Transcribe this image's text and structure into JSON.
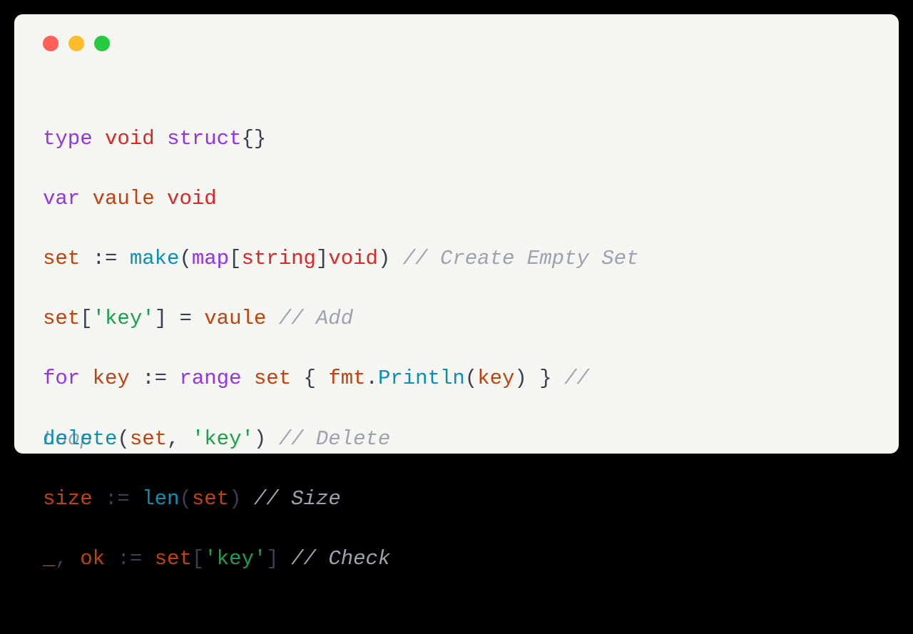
{
  "window": {
    "colors": {
      "red": "#ff5f56",
      "yellow": "#ffbd2e",
      "green": "#27c93f",
      "bg": "#f5f5f2"
    }
  },
  "code": {
    "line1": {
      "kw_type": "type",
      "name": "void",
      "kw_struct": "struct",
      "braces": "{}"
    },
    "line2": {
      "kw_var": "var",
      "name": "vaule",
      "type": "void"
    },
    "line3": {
      "name": "set",
      "op": ":=",
      "fn": "make",
      "lp": "(",
      "kw_map": "map",
      "lb": "[",
      "keytype": "string",
      "rb": "]",
      "valtype": "void",
      "rp": ")",
      "comment": "// Create Empty Set"
    },
    "line4": {
      "name": "set",
      "lb": "[",
      "key": "'key'",
      "rb": "]",
      "eq": "=",
      "val": "vaule",
      "comment": "// Add"
    },
    "line5": {
      "kw_for": "for",
      "var": "key",
      "op": ":=",
      "kw_range": "range",
      "coll": "set",
      "lb": "{",
      "pkg": "fmt",
      "dot": ".",
      "fn": "Println",
      "lp": "(",
      "arg": "key",
      "rp": ")",
      "rb": "}",
      "comment": "//"
    },
    "line6": {
      "back": {
        "word": "Loop"
      },
      "front": {
        "fn": "delete",
        "lp": "(",
        "a1": "set",
        "comma": ",",
        "a2": "'key'",
        "rp": ")",
        "comment": "// Delete"
      }
    },
    "line7": {
      "name": "size",
      "op": ":=",
      "fn": "len",
      "lp": "(",
      "arg": "set",
      "rp": ")",
      "comment": "// Size"
    },
    "line8": {
      "blank": "_",
      "comma": ",",
      "ok": "ok",
      "op": ":=",
      "name": "set",
      "lb": "[",
      "key": "'key'",
      "rb": "]",
      "comment": "// Check"
    }
  }
}
